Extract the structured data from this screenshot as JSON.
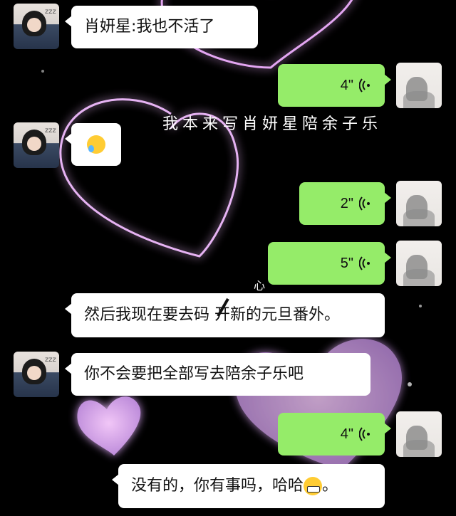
{
  "colors": {
    "background": "#000000",
    "bubble_white": "#ffffff",
    "bubble_green": "#95ec69",
    "heart_glow": "#e7a8f0"
  },
  "overlay": {
    "caption": "我本来写肖妍星陪余子乐",
    "small_text": "心"
  },
  "messages": [
    {
      "side": "left",
      "type": "text",
      "text": "肖妍星:我也不活了"
    },
    {
      "side": "right",
      "type": "voice",
      "duration": "4\""
    },
    {
      "side": "left",
      "type": "emoji",
      "emoji": "crying-laughing-emoji"
    },
    {
      "side": "right",
      "type": "voice",
      "duration": "2\""
    },
    {
      "side": "right",
      "type": "voice",
      "duration": "5\""
    },
    {
      "side": "left",
      "type": "text",
      "text_before": "然后我现在要去码 ",
      "struck_char": "开新",
      "text_after": "的元旦番外。"
    },
    {
      "side": "left",
      "type": "text",
      "text": "你不会要把全部写去陪余子乐吧"
    },
    {
      "side": "right",
      "type": "voice",
      "duration": "4\""
    },
    {
      "side": "left",
      "type": "text",
      "text": "没有的，你有事吗，哈哈",
      "suffix": "。"
    }
  ]
}
